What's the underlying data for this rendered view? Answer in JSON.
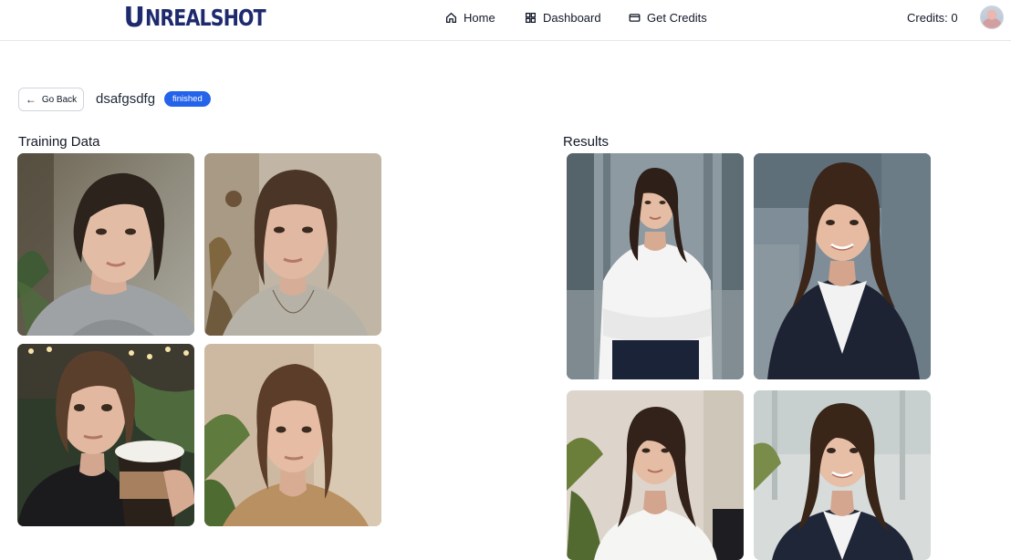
{
  "header": {
    "logo_mark": "U",
    "logo_text": "NREALSHOT",
    "nav": {
      "home": "Home",
      "dashboard": "Dashboard",
      "get_credits": "Get Credits"
    },
    "credits": "Credits: 0"
  },
  "model": {
    "back_label": "Go Back",
    "name": "dsafgsdfg",
    "status": "finished"
  },
  "training": {
    "title": "Training Data",
    "photos": [
      {
        "kind": "selfie-gray-sweater"
      },
      {
        "kind": "selfie-plants"
      },
      {
        "kind": "selfie-coffee-cup"
      },
      {
        "kind": "portrait-beige-wall"
      }
    ]
  },
  "results": {
    "title": "Results",
    "photos": [
      {
        "kind": "headshot-white-shirt-arms-crossed"
      },
      {
        "kind": "headshot-navy-blazer"
      },
      {
        "kind": "headshot-white-shirt-office"
      },
      {
        "kind": "headshot-blazer-window"
      }
    ]
  },
  "colors": {
    "brand": "#1e2a6e",
    "badge": "#2563eb"
  }
}
